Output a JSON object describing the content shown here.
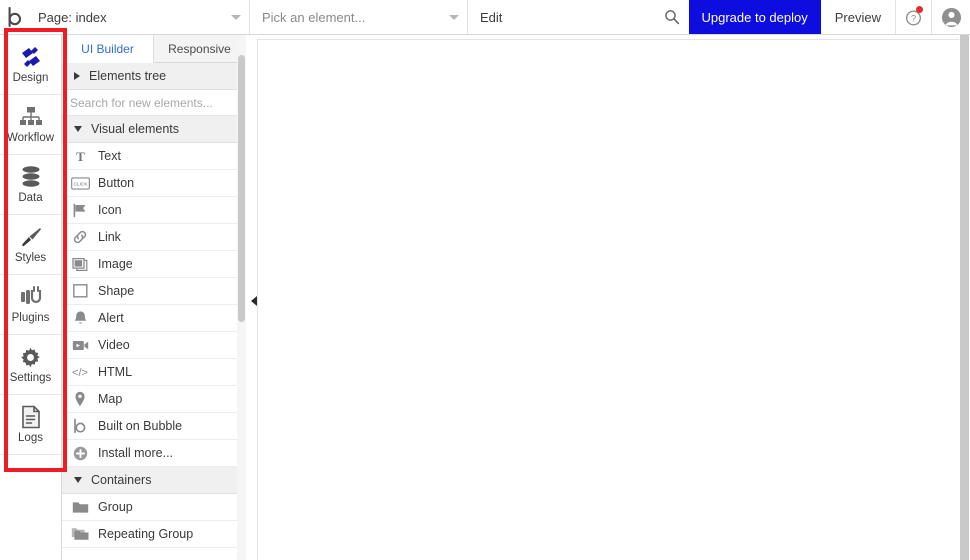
{
  "topbar": {
    "logo_icon": "bubble-b-logo",
    "page_selector": {
      "label": "Page: index",
      "icon": "chevron-down-icon"
    },
    "element_selector": {
      "placeholder": "Pick an element...",
      "label": "Pick an element...",
      "icon": "chevron-down-icon"
    },
    "edit_label": "Edit",
    "search_icon": "search-icon",
    "upgrade_button": "Upgrade to deploy",
    "preview_button": "Preview",
    "help_icon": "question-circle-icon",
    "avatar_icon": "user-avatar-icon",
    "accent_blue": "#0D0DE0"
  },
  "rail": {
    "items": [
      {
        "label": "Design",
        "icon": "design-pencil-ruler-icon",
        "active": true
      },
      {
        "label": "Workflow",
        "icon": "workflow-hierarchy-icon",
        "active": false
      },
      {
        "label": "Data",
        "icon": "database-icon",
        "active": false
      },
      {
        "label": "Styles",
        "icon": "paintbrush-icon",
        "active": false
      },
      {
        "label": "Plugins",
        "icon": "plug-icon",
        "active": false
      },
      {
        "label": "Settings",
        "icon": "gear-icon",
        "active": false
      },
      {
        "label": "Logs",
        "icon": "document-lines-icon",
        "active": false
      }
    ],
    "highlight_color": "#ee1c25"
  },
  "panel": {
    "tabs": [
      {
        "label": "UI Builder",
        "active": true
      },
      {
        "label": "Responsive",
        "active": false
      }
    ],
    "elements_tree": {
      "label": "Elements tree",
      "expanded": false
    },
    "search": {
      "placeholder": "Search for new elements...",
      "value": ""
    },
    "sections": [
      {
        "label": "Visual elements",
        "expanded": true,
        "items": [
          {
            "label": "Text",
            "icon": "text-t-icon"
          },
          {
            "label": "Button",
            "icon": "button-click-icon"
          },
          {
            "label": "Icon",
            "icon": "flag-icon"
          },
          {
            "label": "Link",
            "icon": "chain-link-icon"
          },
          {
            "label": "Image",
            "icon": "image-icon"
          },
          {
            "label": "Shape",
            "icon": "square-shape-icon"
          },
          {
            "label": "Alert",
            "icon": "bell-icon"
          },
          {
            "label": "Video",
            "icon": "video-camera-icon"
          },
          {
            "label": "HTML",
            "icon": "code-brackets-icon"
          },
          {
            "label": "Map",
            "icon": "map-pin-icon"
          },
          {
            "label": "Built on Bubble",
            "icon": "bubble-b-icon"
          },
          {
            "label": "Install more...",
            "icon": "plus-circle-icon"
          }
        ]
      },
      {
        "label": "Containers",
        "expanded": true,
        "items": [
          {
            "label": "Group",
            "icon": "folder-icon"
          },
          {
            "label": "Repeating Group",
            "icon": "folder-stack-icon"
          }
        ]
      }
    ],
    "collapse_handle_icon": "chevron-left-icon"
  },
  "canvas": {
    "content": ""
  }
}
